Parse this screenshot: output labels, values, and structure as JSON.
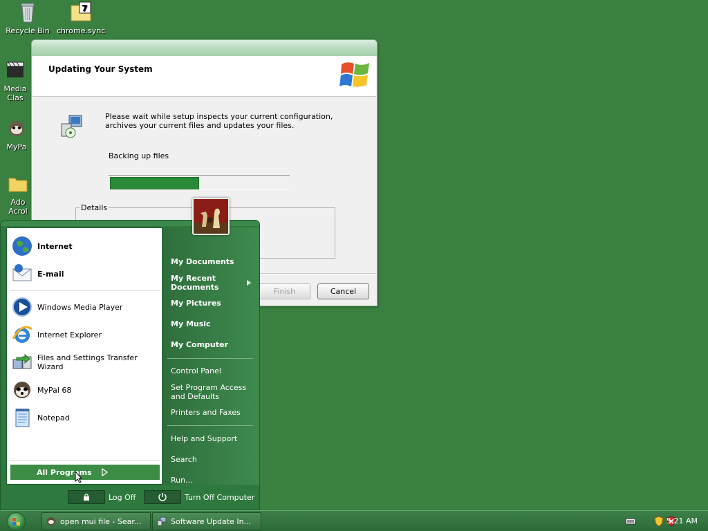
{
  "desktop": {
    "icons": [
      {
        "label": "Recycle Bin"
      },
      {
        "label": "chrome.sync"
      },
      {
        "label": "Media Clas"
      },
      {
        "label": "MyPa"
      },
      {
        "label": "Ado Acrol"
      }
    ]
  },
  "dialog": {
    "header_title": "Updating Your System",
    "message": "Please wait while setup inspects your current configuration, archives your current files and updates your files.",
    "status": "Backing up files",
    "progress": 0.5,
    "details_label": "Details",
    "buttons": {
      "finish": "Finish",
      "cancel": "Cancel"
    }
  },
  "start_menu": {
    "pinned": [
      {
        "label": "Internet",
        "icon": "globe-icon"
      },
      {
        "label": "E-mail",
        "icon": "email-icon"
      }
    ],
    "recent": [
      {
        "label": "Windows Media Player",
        "icon": "media-player-icon"
      },
      {
        "label": "Internet Explorer",
        "icon": "internet-explorer-icon"
      },
      {
        "label": "Files and Settings Transfer Wizard",
        "icon": "transfer-wizard-icon"
      },
      {
        "label": "MyPal 68",
        "icon": "mypal-icon"
      },
      {
        "label": "Notepad",
        "icon": "notepad-icon"
      }
    ],
    "all_programs": "All Programs",
    "right": {
      "my_documents": "My Documents",
      "my_recent_documents": "My Recent Documents",
      "my_pictures": "My Pictures",
      "my_music": "My Music",
      "my_computer": "My Computer",
      "control_panel": "Control Panel",
      "set_program_access": "Set Program Access and Defaults",
      "printers_faxes": "Printers and Faxes",
      "help_support": "Help and Support",
      "search": "Search",
      "run": "Run..."
    },
    "log_off": "Log Off",
    "turn_off": "Turn Off Computer"
  },
  "taskbar": {
    "buttons": [
      {
        "label": "open mui file - Sear...",
        "icon": "browser-icon"
      },
      {
        "label": "Software Update In...",
        "icon": "setup-icon"
      }
    ],
    "clock": "5:21 AM"
  },
  "colors": {
    "desktop": "#3a8040",
    "start_menu": "#2e7a3e",
    "progress": "#2a8a38"
  }
}
